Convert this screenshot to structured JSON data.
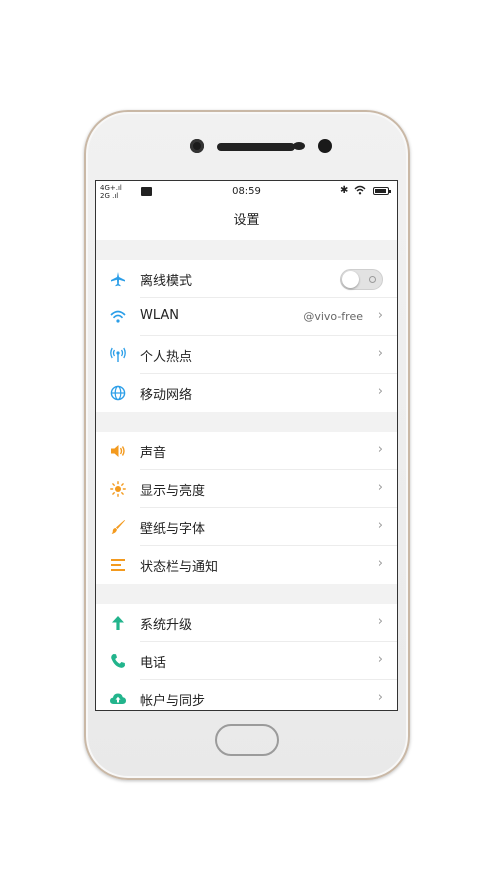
{
  "status_bar": {
    "signal_top": "4G+.ıl",
    "signal_bottom": "2G .ıl",
    "time": "08:59",
    "bluetooth_glyph": "✱",
    "battery_level_pct": 95
  },
  "header": {
    "title": "设置"
  },
  "groups": [
    {
      "items": [
        {
          "id": "airplane",
          "label": "离线模式",
          "icon": "airplane-icon",
          "icon_color": "#2b9ee8",
          "control": "toggle",
          "toggle_on": false
        },
        {
          "id": "wlan",
          "label": "WLAN",
          "icon": "wifi-icon",
          "icon_color": "#2b9ee8",
          "value": "@vivo-free",
          "chevron": "›"
        },
        {
          "id": "hotspot",
          "label": "个人热点",
          "icon": "hotspot-icon",
          "icon_color": "#2b9ee8",
          "chevron": "›"
        },
        {
          "id": "mobile-network",
          "label": "移动网络",
          "icon": "globe-icon",
          "icon_color": "#2b9ee8",
          "chevron": "›"
        }
      ]
    },
    {
      "items": [
        {
          "id": "sound",
          "label": "声音",
          "icon": "speaker-icon",
          "icon_color": "#f39a1e",
          "chevron": "›"
        },
        {
          "id": "display",
          "label": "显示与亮度",
          "icon": "sun-icon",
          "icon_color": "#f39a1e",
          "chevron": "›"
        },
        {
          "id": "wallpaper",
          "label": "壁纸与字体",
          "icon": "brush-icon",
          "icon_color": "#f39a1e",
          "chevron": "›"
        },
        {
          "id": "statusbar",
          "label": "状态栏与通知",
          "icon": "list-icon",
          "icon_color": "#f39a1e",
          "chevron": "›"
        }
      ]
    },
    {
      "items": [
        {
          "id": "update",
          "label": "系统升级",
          "icon": "arrow-up-icon",
          "icon_color": "#22b48c",
          "chevron": "›"
        },
        {
          "id": "phone",
          "label": "电话",
          "icon": "phone-icon",
          "icon_color": "#22b48c",
          "chevron": "›"
        },
        {
          "id": "account",
          "label": "帐户与同步",
          "icon": "cloud-sync-icon",
          "icon_color": "#22b48c",
          "chevron": "›"
        }
      ]
    }
  ]
}
